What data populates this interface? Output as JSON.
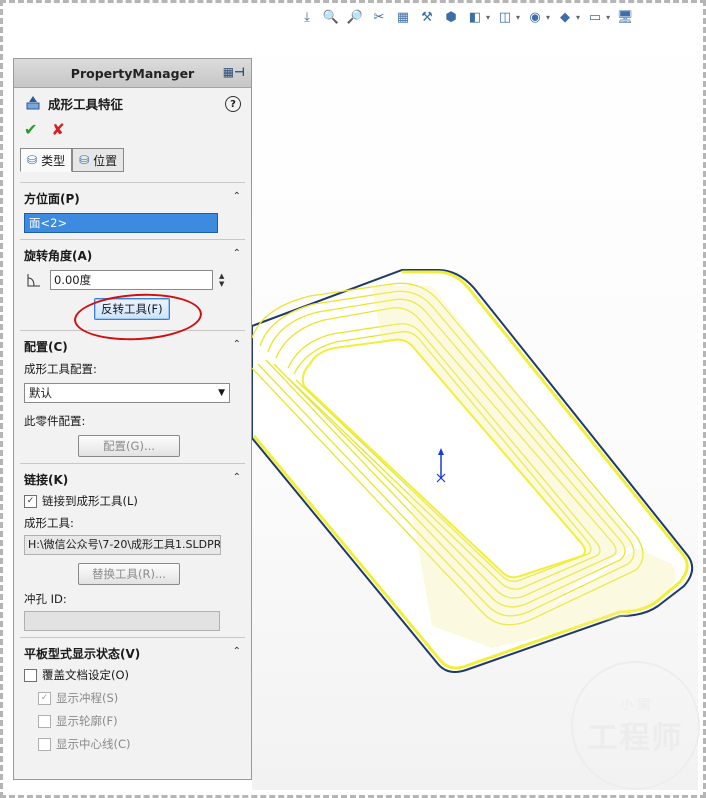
{
  "property_manager": {
    "title": "PropertyManager",
    "feature_title": "成形工具特征",
    "help": "?",
    "ok_symbol": "✔",
    "cancel_symbol": "✘",
    "tabs": [
      {
        "label": "类型",
        "active": true
      },
      {
        "label": "位置",
        "active": false
      }
    ],
    "sections": {
      "face": {
        "title": "方位面(P)",
        "selection": "面<2>"
      },
      "rotation": {
        "title": "旋转角度(A)",
        "value": "0.00度",
        "flip_button": "反转工具(F)"
      },
      "config": {
        "title": "配置(C)",
        "tool_config_label": "成形工具配置:",
        "tool_config_value": "默认",
        "part_config_label": "此零件配置:",
        "config_button": "配置(G)..."
      },
      "link": {
        "title": "链接(K)",
        "link_checkbox": "链接到成形工具(L)",
        "link_checked": true,
        "tool_label": "成形工具:",
        "tool_path": "H:\\微信公众号\\7-20\\成形工具1.SLDPR",
        "replace_button": "替换工具(R)...",
        "punch_label": "冲孔 ID:",
        "punch_value": ""
      },
      "display": {
        "title": "平板型式显示状态(V)",
        "override": {
          "label": "覆盖文档设定(O)",
          "checked": false
        },
        "options": [
          {
            "label": "显示冲程(S)",
            "checked": true
          },
          {
            "label": "显示轮廓(F)",
            "checked": false
          },
          {
            "label": "显示中心线(C)",
            "checked": false
          }
        ]
      }
    }
  },
  "watermark": {
    "top": "小 國",
    "big": "工程师"
  },
  "colors": {
    "selection": "#3c8be0",
    "highlight": "#f2ef3a",
    "edge": "#1e3a6a",
    "annotation": "#d01010"
  }
}
